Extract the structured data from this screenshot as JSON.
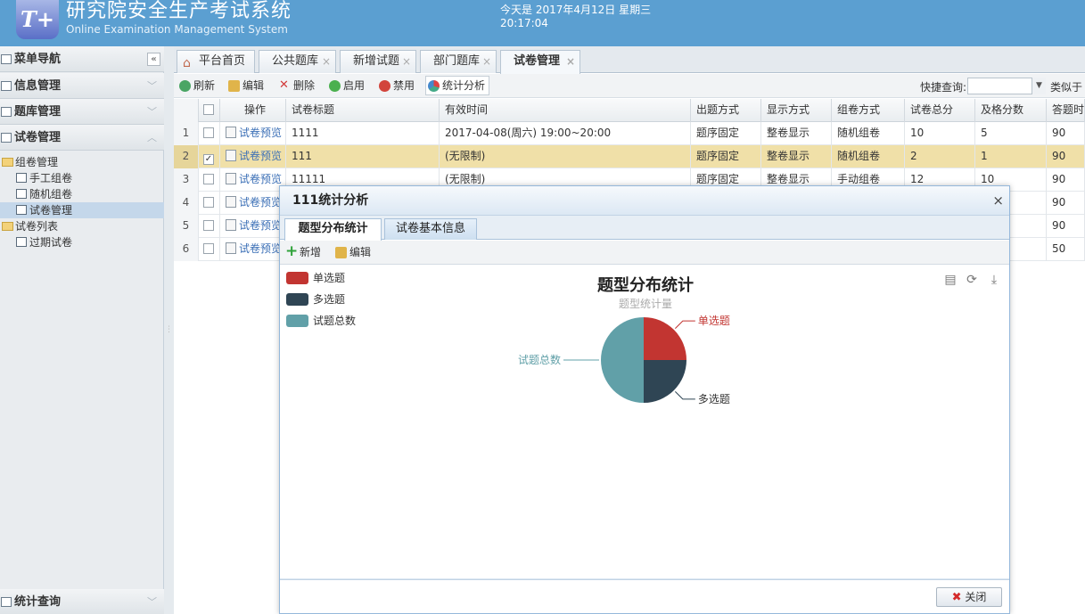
{
  "app": {
    "title": "研究院安全生产考试系统",
    "subtitle": "Online Examination Management System",
    "date_line": "今天是 2017年4月12日 星期三",
    "time_line": "20:17:04",
    "logo_text": "T+"
  },
  "sidebar": {
    "panels": [
      "菜单导航",
      "信息管理",
      "题库管理",
      "试卷管理",
      "统计查询"
    ],
    "collapse_glyph": "«",
    "tree": [
      {
        "label": "组卷管理",
        "type": "folder"
      },
      {
        "label": "手工组卷",
        "type": "doc"
      },
      {
        "label": "随机组卷",
        "type": "doc"
      },
      {
        "label": "试卷管理",
        "type": "doc",
        "selected": true
      },
      {
        "label": "试卷列表",
        "type": "folder"
      },
      {
        "label": "过期试卷",
        "type": "doc"
      }
    ]
  },
  "tabs": [
    "平台首页",
    "公共题库",
    "新增试题",
    "部门题库",
    "试卷管理"
  ],
  "toolbar": {
    "buttons": [
      "刷新",
      "编辑",
      "删除",
      "启用",
      "禁用",
      "统计分析"
    ],
    "quick_search_label": "快捷查询:",
    "quick_search_value": "",
    "similar_label": "类似于"
  },
  "grid": {
    "columns": [
      "操作",
      "试卷标题",
      "有效时间",
      "出题方式",
      "显示方式",
      "组卷方式",
      "试卷总分",
      "及格分数",
      "答题时"
    ],
    "rows": [
      {
        "no": "1",
        "checked": false,
        "op": "试卷预览",
        "title": "1111",
        "time": "2017-04-08(周六) 19:00~20:00",
        "order": "题序固定",
        "display": "整卷显示",
        "compose": "随机组卷",
        "total": "10",
        "pass": "5",
        "duration": "90"
      },
      {
        "no": "2",
        "checked": true,
        "op": "试卷预览",
        "title": "111",
        "time": "(无限制)",
        "order": "题序固定",
        "display": "整卷显示",
        "compose": "随机组卷",
        "total": "2",
        "pass": "1",
        "duration": "90"
      },
      {
        "no": "3",
        "checked": false,
        "op": "试卷预览",
        "title": "11111",
        "time": "(无限制)",
        "order": "题序固定",
        "display": "整卷显示",
        "compose": "手动组卷",
        "total": "12",
        "pass": "10",
        "duration": "90"
      },
      {
        "no": "4",
        "checked": false,
        "op": "试卷预览",
        "title": "",
        "time": "",
        "order": "",
        "display": "",
        "compose": "",
        "total": "",
        "pass": "",
        "duration": "90"
      },
      {
        "no": "5",
        "checked": false,
        "op": "试卷预览",
        "title": "",
        "time": "",
        "order": "",
        "display": "",
        "compose": "",
        "total": "",
        "pass": "",
        "duration": "90"
      },
      {
        "no": "6",
        "checked": false,
        "op": "试卷预览",
        "title": "",
        "time": "",
        "order": "",
        "display": "",
        "compose": "",
        "total": "",
        "pass": "",
        "duration": "50"
      }
    ]
  },
  "modal": {
    "title": "111统计分析",
    "close_glyph": "×",
    "tabs": [
      "题型分布统计",
      "试卷基本信息"
    ],
    "toolbar": [
      "新增",
      "编辑"
    ],
    "close_button": "关闭"
  },
  "chart_data": {
    "type": "pie",
    "title": "题型分布统计",
    "subtitle": "题型统计量",
    "legend_position": "top-left",
    "categories": [
      "单选题",
      "多选题",
      "试题总数"
    ],
    "values": [
      1,
      1,
      2
    ],
    "colors": [
      "#c23531",
      "#2f4554",
      "#61a0a8"
    ]
  }
}
